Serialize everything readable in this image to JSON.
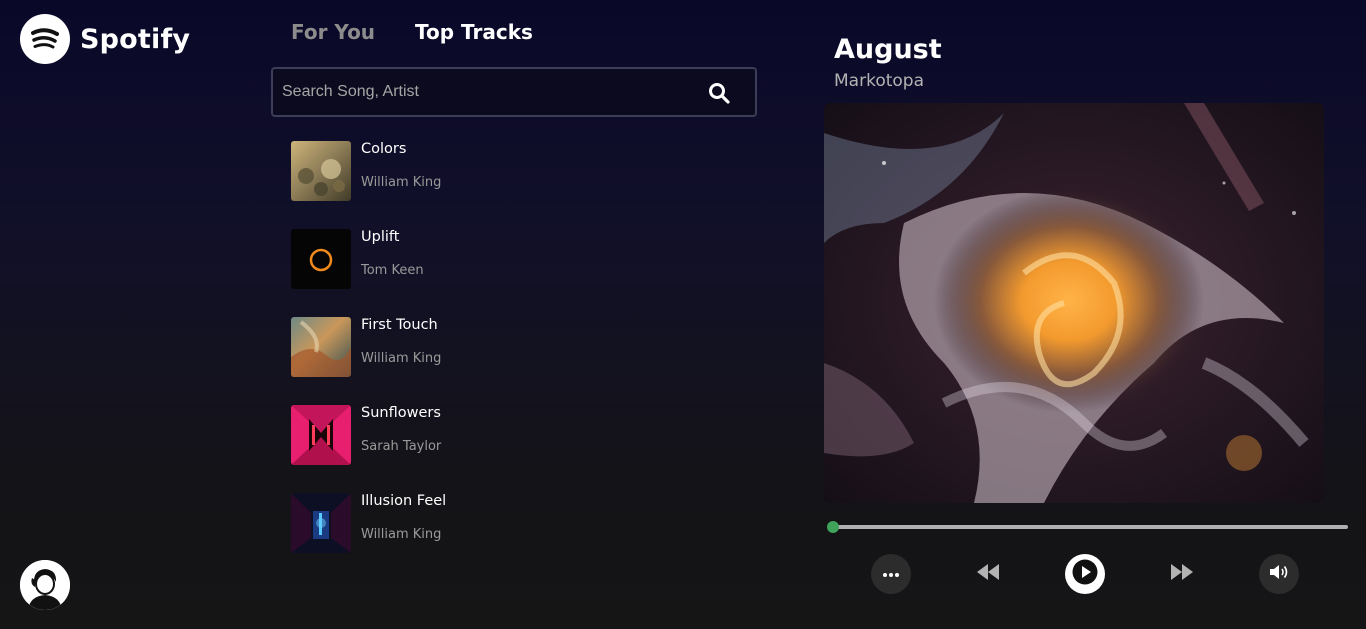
{
  "brand": {
    "name": "Spotify"
  },
  "tabs": [
    {
      "label": "For You",
      "active": false
    },
    {
      "label": "Top Tracks",
      "active": true
    }
  ],
  "search": {
    "placeholder": "Search Song, Artist",
    "value": ""
  },
  "tracks": [
    {
      "title": "Colors",
      "artist": "William King"
    },
    {
      "title": "Uplift",
      "artist": "Tom Keen"
    },
    {
      "title": "First Touch",
      "artist": "William King"
    },
    {
      "title": "Sunflowers",
      "artist": "Sarah Taylor"
    },
    {
      "title": "Illusion Feel",
      "artist": "William King"
    }
  ],
  "now_playing": {
    "title": "August",
    "artist": "Markotopa",
    "progress": 0.01
  },
  "controls": [
    "more-icon",
    "previous-icon",
    "play-icon",
    "next-icon",
    "volume-icon"
  ],
  "colors": {
    "accent": "#3fa35a",
    "background_top": "#0a0829",
    "background_bottom": "#151515",
    "muted_text": "#9a9a9a"
  }
}
